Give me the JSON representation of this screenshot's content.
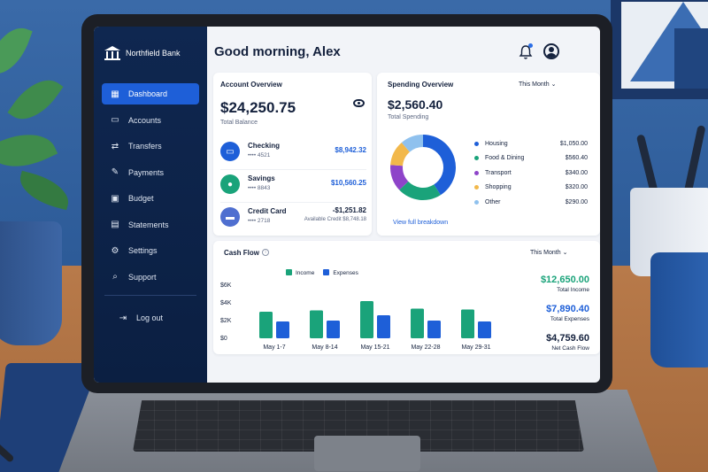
{
  "app": {
    "brand": "Northfield Bank",
    "greeting": "Good morning, Alex"
  },
  "sidebar": {
    "items": [
      {
        "label": "Dashboard",
        "icon": "grid-icon",
        "active": true
      },
      {
        "label": "Accounts",
        "icon": "wallet-icon"
      },
      {
        "label": "Transfers",
        "icon": "transfer-icon"
      },
      {
        "label": "Payments",
        "icon": "payment-icon"
      },
      {
        "label": "Budget",
        "icon": "budget-icon"
      },
      {
        "label": "Statements",
        "icon": "document-icon"
      },
      {
        "label": "Settings",
        "icon": "gear-icon"
      },
      {
        "label": "Support",
        "icon": "search-icon"
      }
    ],
    "logout": "Log out"
  },
  "account_overview": {
    "title": "Account Overview",
    "balance": "$24,250.75",
    "balance_label": "Total Balance",
    "accounts": [
      {
        "name": "Checking",
        "number": "•••• 4521",
        "amount": "$8,942.32",
        "color": "#1e5fd8"
      },
      {
        "name": "Savings",
        "number": "•••• 8843",
        "amount": "$10,560.25",
        "color": "#1aa37a"
      },
      {
        "name": "Credit Card",
        "number": "•••• 2718",
        "amount": "-$1,251.82",
        "sub": "Available Credit $8,748.18",
        "color": "#4f6fd0"
      }
    ]
  },
  "spending_overview": {
    "title": "Spending Overview",
    "period": "This Month",
    "amount": "$2,560.40",
    "amount_label": "Total Spending",
    "link": "View full breakdown",
    "categories": [
      {
        "name": "Housing",
        "value": "$1,050.00",
        "amount": 1050,
        "color": "#1e5fd8"
      },
      {
        "name": "Food & Dining",
        "value": "$560.40",
        "amount": 560.4,
        "color": "#1aa37a"
      },
      {
        "name": "Transport",
        "value": "$340.00",
        "amount": 340,
        "color": "#8e44c9"
      },
      {
        "name": "Shopping",
        "value": "$320.00",
        "amount": 320,
        "color": "#f2b84b"
      },
      {
        "name": "Other",
        "value": "$290.00",
        "amount": 290,
        "color": "#8fc1ee"
      }
    ]
  },
  "cash_flow": {
    "title": "Cash Flow",
    "period": "This Month",
    "legend_income": "Income",
    "legend_expenses": "Expenses",
    "income_color": "#1aa37a",
    "expense_color": "#1e5fd8",
    "stats": [
      {
        "value": "$12,650.00",
        "label": "Total Income",
        "color": "#1aa37a"
      },
      {
        "value": "$7,890.40",
        "label": "Total Expenses",
        "color": "#1e5fd8"
      },
      {
        "value": "$4,759.60",
        "label": "Net Cash Flow",
        "color": "#14213d"
      }
    ]
  },
  "chart_data": {
    "type": "bar",
    "title": "Cash Flow",
    "categories": [
      "May 1-7",
      "May 8-14",
      "May 15-21",
      "May 22-28",
      "May 29-31"
    ],
    "series": [
      {
        "name": "Income",
        "values": [
          3000,
          3150,
          4200,
          3350,
          3250
        ]
      },
      {
        "name": "Expenses",
        "values": [
          1900,
          2000,
          2600,
          2000,
          1900
        ]
      }
    ],
    "yticks": [
      "$6K",
      "$4K",
      "$2K",
      "$0"
    ],
    "ylim": [
      0,
      6000
    ]
  }
}
